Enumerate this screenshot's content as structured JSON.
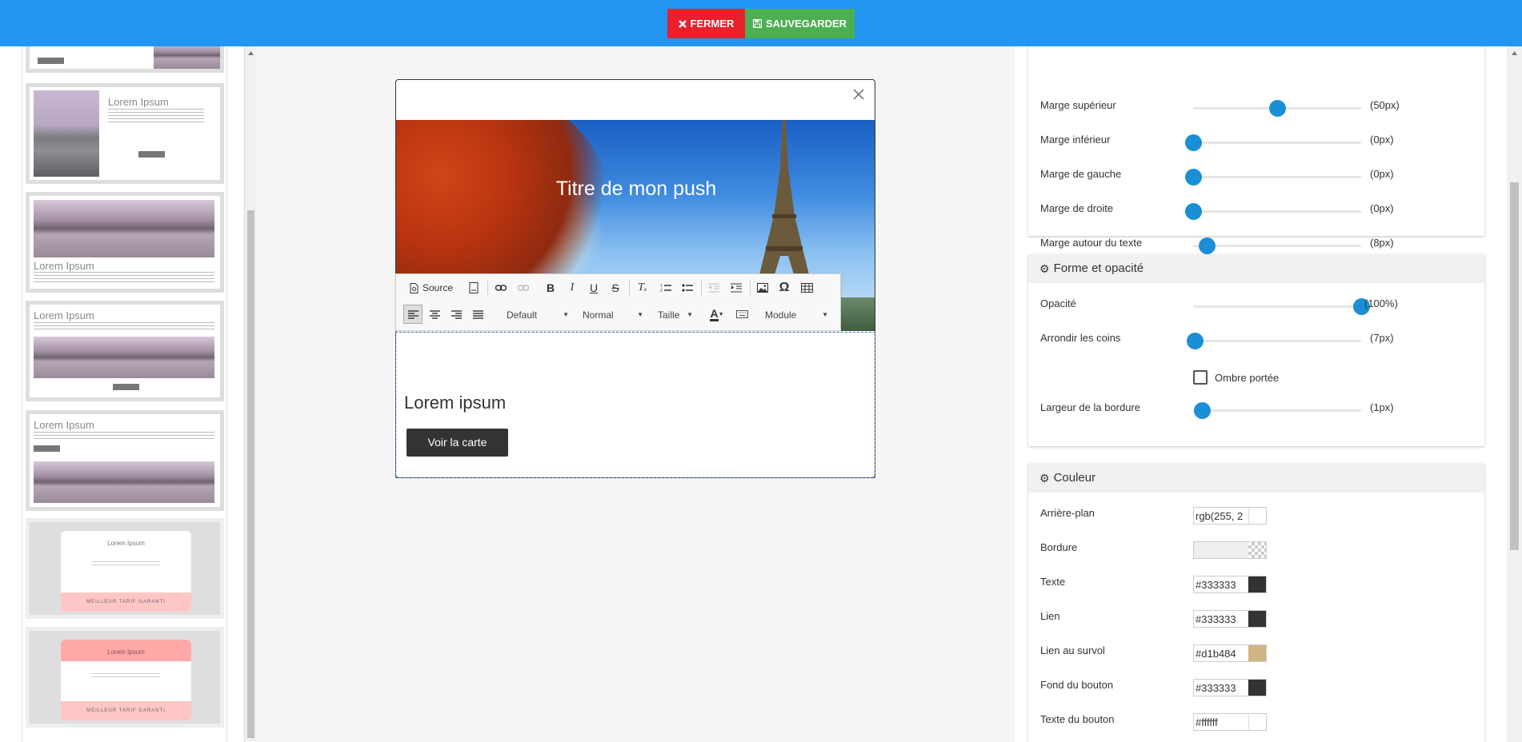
{
  "topbar": {
    "close_label": "FERMER",
    "save_label": "SAUVEGARDER",
    "close_color": "#e8212b",
    "save_color": "#4caf50"
  },
  "thumbnails": [
    {
      "title": "",
      "button": "CLICK ME"
    },
    {
      "title": "Lorem Ipsum",
      "button": "CLICK ME"
    },
    {
      "title": "Lorem Ipsum"
    },
    {
      "title": "Lorem Ipsum",
      "button": "CLICK ME"
    },
    {
      "title": "Lorem Ipsum",
      "button": "CLICK ME"
    },
    {
      "title": "Lorem Ipsum",
      "text": "Neque porro quisquam est qui dolorem ipsum quia dolor sit amet, consectetur, adipisci velit...",
      "footer": "MEILLEUR TARIF GARANTI"
    },
    {
      "title": "Lorem Ipsum",
      "text": "Neque porro quisquam est qui dolorem ipsum quia dolor sit amet, consectetur, adipisci velit...",
      "footer": "MEILLEUR TARIF GARANTI"
    }
  ],
  "preview": {
    "hero_title": "Titre de mon push",
    "heading": "Lorem ipsum",
    "button": "Voir la carte"
  },
  "editor_toolbar": {
    "source": "Source",
    "styles": "Default",
    "format": "Normal",
    "size": "Taille",
    "module": "Module"
  },
  "margins": [
    {
      "label": "Marge supérieur",
      "value": "(50px)",
      "level": 0.5
    },
    {
      "label": "Marge inférieur",
      "value": "(0px)",
      "level": 0
    },
    {
      "label": "Marge de gauche",
      "value": "(0px)",
      "level": 0
    },
    {
      "label": "Marge de droite",
      "value": "(0px)",
      "level": 0
    },
    {
      "label": "Marge autour du texte",
      "value": "(8px)",
      "level": 0.08
    }
  ],
  "shape": {
    "title": "Forme et opacité",
    "opacity": {
      "label": "Opacité",
      "value": "(100%)",
      "level": 1
    },
    "corners": {
      "label": "Arrondir les coins",
      "value": "(7px)",
      "level": 0.01
    },
    "shadow": {
      "label": "Ombre portée",
      "checked": false
    },
    "border_width": {
      "label": "Largeur de la bordure",
      "value": "(1px)",
      "level": 0.05
    }
  },
  "color": {
    "title": "Couleur",
    "rows": [
      {
        "label": "Arrière-plan",
        "value": "rgb(255, 2",
        "swatch": "#ffffff"
      },
      {
        "label": "Bordure",
        "value": "",
        "swatch": "transparent"
      },
      {
        "label": "Texte",
        "value": "#333333",
        "swatch": "#333333"
      },
      {
        "label": "Lien",
        "value": "#333333",
        "swatch": "#333333"
      },
      {
        "label": "Lien au survol",
        "value": "#d1b484",
        "swatch": "#d1b484"
      },
      {
        "label": "Fond du bouton",
        "value": "#333333",
        "swatch": "#333333"
      },
      {
        "label": "Texte du bouton",
        "value": "#ffffff",
        "swatch": "#ffffff"
      }
    ]
  },
  "accent_color": "#2196f3",
  "slider_color": "#1a8fd6"
}
